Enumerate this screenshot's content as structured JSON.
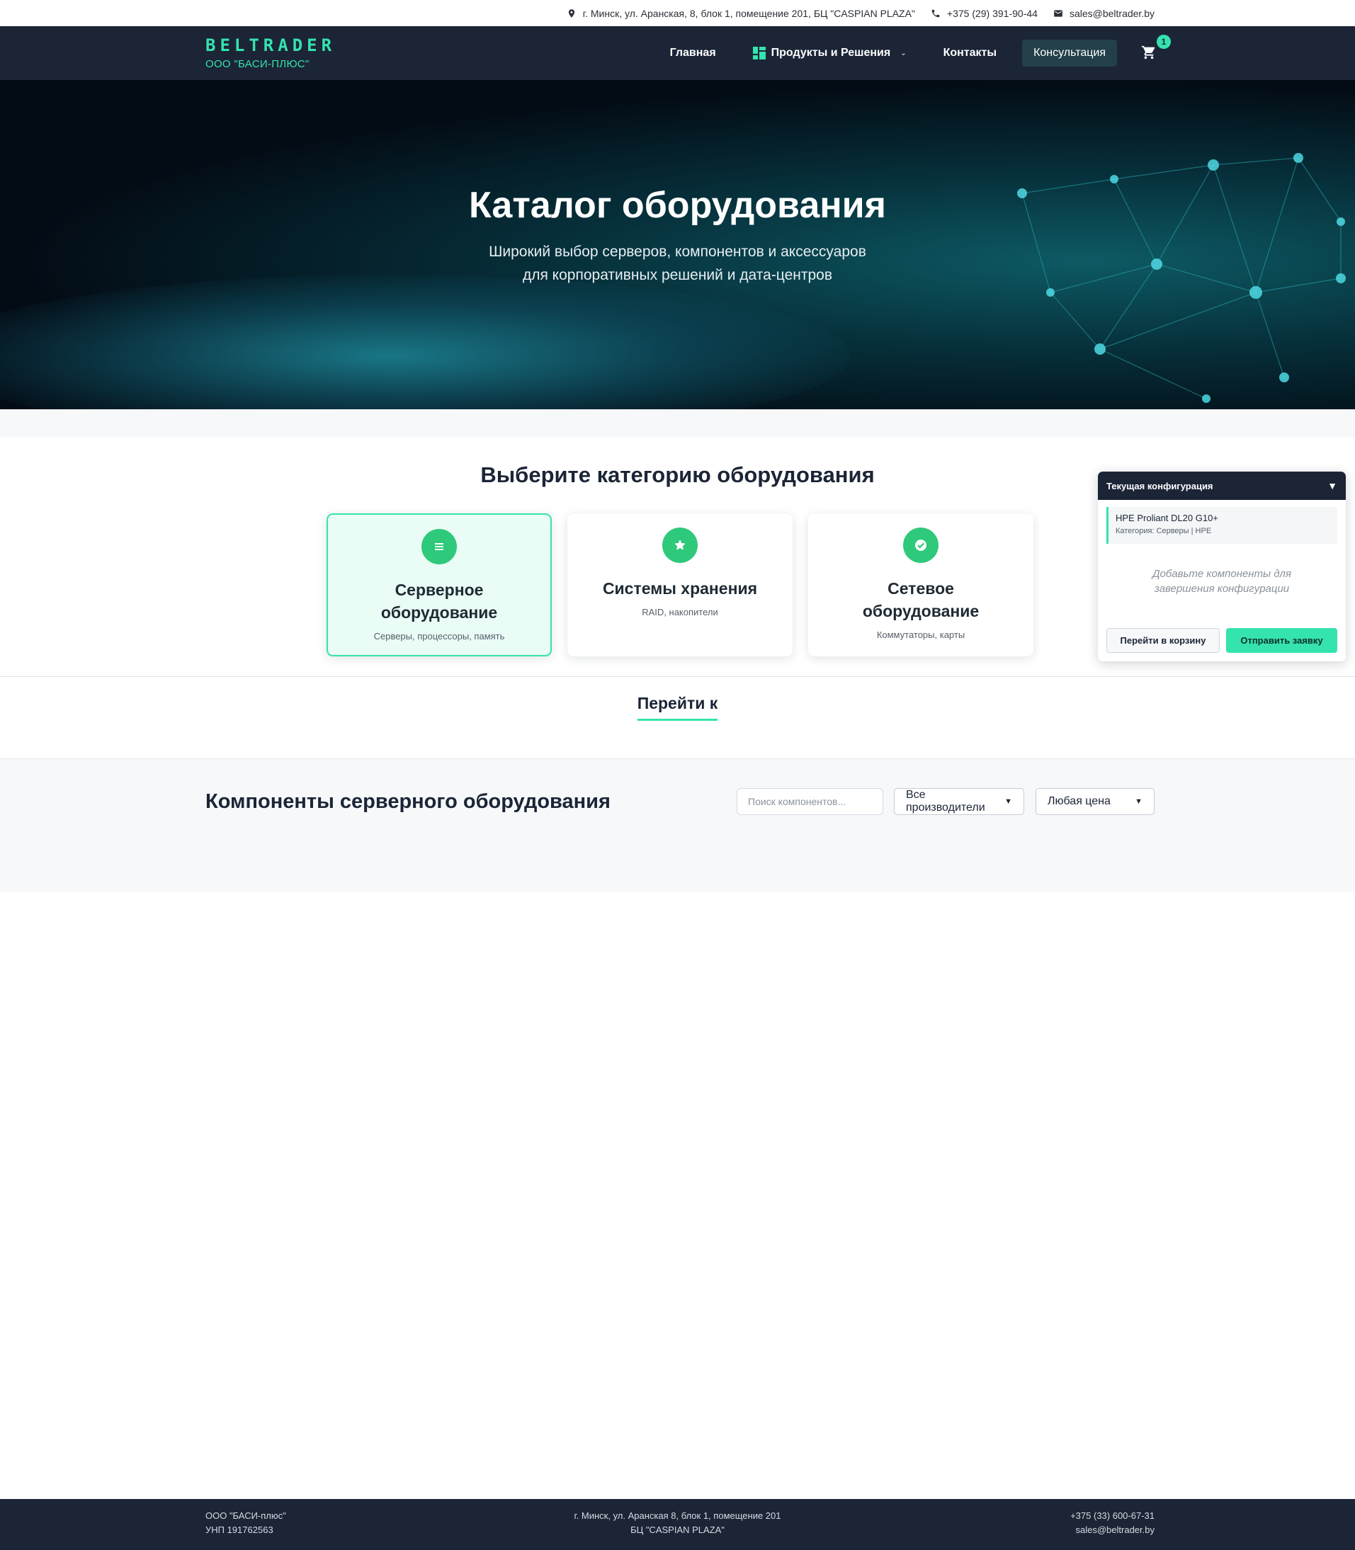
{
  "topbar": {
    "address": "г. Минск, ул. Аранская, 8, блок 1, помещение 201, БЦ \"CASPIAN PLAZA\"",
    "phone": "+375 (29) 391-90-44",
    "email": "sales@beltrader.by"
  },
  "header": {
    "logo": "BELTRADER",
    "company": "ООО \"БАСИ-ПЛЮС\"",
    "nav": {
      "home": "Главная",
      "products": "Продукты и Решения",
      "contacts": "Контакты",
      "consult": "Консультация"
    },
    "cart_count": "1"
  },
  "hero": {
    "title": "Каталог оборудования",
    "subtitle_line1": "Широкий выбор серверов, компонентов и аксессуаров",
    "subtitle_line2": "для корпоративных решений и дата-центров"
  },
  "categories": {
    "heading": "Выберите категорию оборудования",
    "items": [
      {
        "title": "Серверное оборудование",
        "sub": "Серверы, процессоры, память",
        "icon": "list-icon",
        "active": true
      },
      {
        "title": "Системы хранения",
        "sub": "RAID, накопители",
        "icon": "star-icon",
        "active": false
      },
      {
        "title": "Сетевое оборудование",
        "sub": "Коммутаторы, карты",
        "icon": "check-icon",
        "active": false
      }
    ]
  },
  "goto": {
    "label": "Перейти к"
  },
  "components": {
    "title": "Компоненты серверного оборудования",
    "search_placeholder": "Поиск компонентов...",
    "manufacturer": "Все производители",
    "price": "Любая цена"
  },
  "config": {
    "title": "Текущая конфигурация",
    "toggle": "▼",
    "item_name": "HPE Proliant DL20 G10+",
    "item_meta": "Категория: Серверы | HPE",
    "hint": "Добавьте компоненты для завершения конфигурации",
    "btn_cart": "Перейти в корзину",
    "btn_send": "Отправить заявку"
  },
  "footer": {
    "company": "ООО \"БАСИ-плюс\"",
    "unp": "УНП 191762563",
    "address1": "г. Минск, ул. Аранская 8, блок 1, помещение 201",
    "address2": "БЦ \"CASPIAN PLAZA\"",
    "phone": "+375 (33) 600-67-31",
    "email": "sales@beltrader.by"
  },
  "colors": {
    "accent": "#35e3ae",
    "navy": "#1b2536",
    "green_icon": "#2ec97a"
  }
}
